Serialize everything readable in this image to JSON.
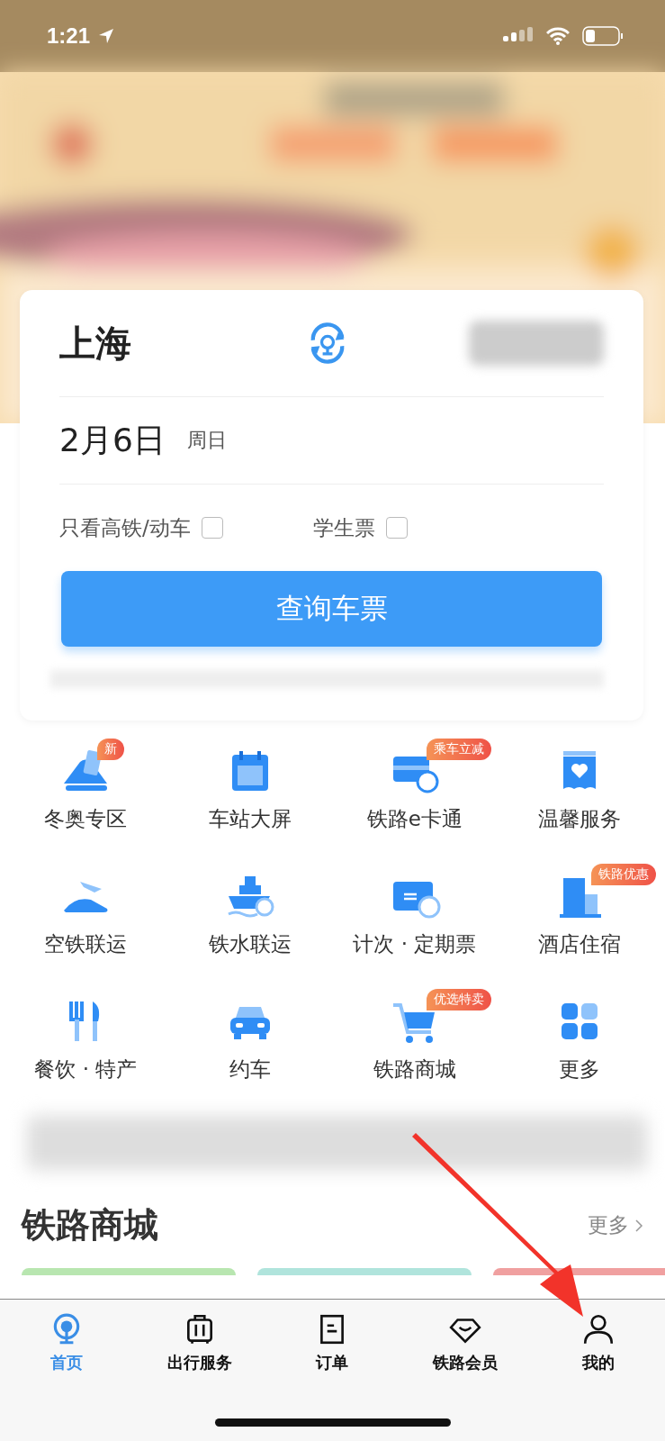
{
  "status_bar": {
    "time": "1:21"
  },
  "search_card": {
    "from_city": "上海",
    "date": "2月6日",
    "weekday": "周日",
    "options": [
      {
        "label": "只看高铁/动车",
        "checked": false
      },
      {
        "label": "学生票",
        "checked": false
      }
    ],
    "search_button": "查询车票"
  },
  "services": [
    {
      "label": "冬奥专区",
      "badge": "新"
    },
    {
      "label": "车站大屏"
    },
    {
      "label": "铁路e卡通",
      "badge": "乘车立减"
    },
    {
      "label": "温馨服务"
    },
    {
      "label": "空铁联运"
    },
    {
      "label": "铁水联运"
    },
    {
      "label": "计次 · 定期票"
    },
    {
      "label": "酒店住宿",
      "badge": "铁路优惠"
    },
    {
      "label": "餐饮 · 特产"
    },
    {
      "label": "约车"
    },
    {
      "label": "铁路商城",
      "badge": "优选特卖"
    },
    {
      "label": "更多"
    }
  ],
  "mall_section": {
    "title": "铁路商城",
    "more": "更多"
  },
  "tab_bar": [
    {
      "label": "首页",
      "selected": true
    },
    {
      "label": "出行服务",
      "selected": false
    },
    {
      "label": "订单",
      "selected": false
    },
    {
      "label": "铁路会员",
      "selected": false
    },
    {
      "label": "我的",
      "selected": false
    }
  ]
}
